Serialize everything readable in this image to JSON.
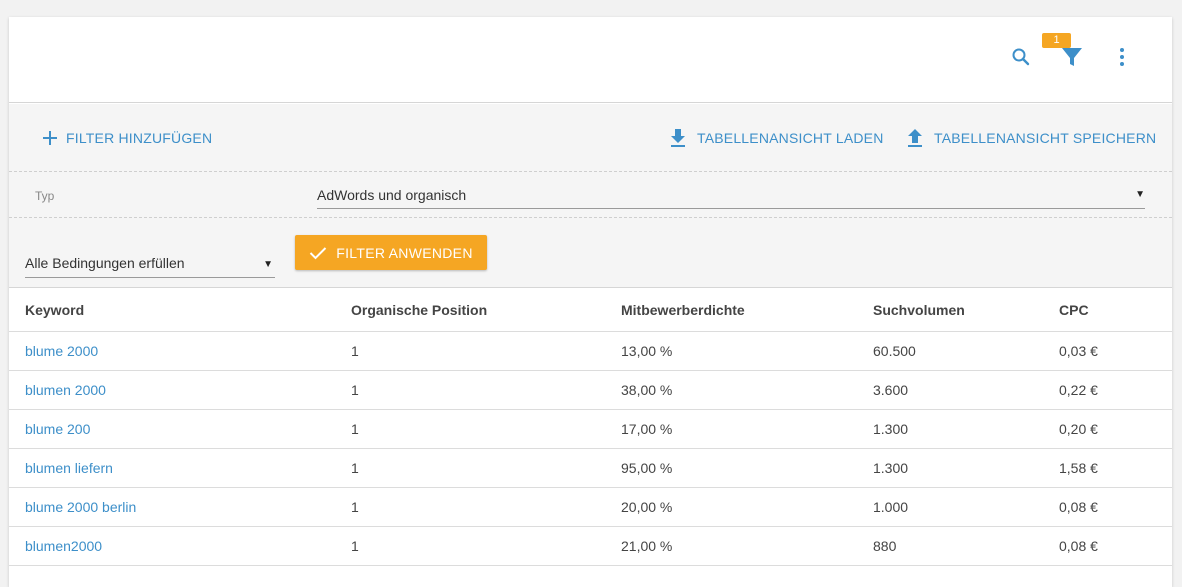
{
  "toolbar": {
    "filter_badge": "1",
    "icons": [
      "search-icon",
      "filter-icon",
      "more-vert-icon"
    ]
  },
  "actions": {
    "add_filter": "FILTER HINZUFÜGEN",
    "load_view": "TABELLENANSICHT LADEN",
    "save_view": "TABELLENANSICHT SPEICHERN"
  },
  "filter": {
    "type_label": "Typ",
    "type_value": "AdWords und organisch",
    "condition_value": "Alle Bedingungen erfüllen",
    "apply_label": "FILTER ANWENDEN"
  },
  "table": {
    "headers": [
      "Keyword",
      "Organische Position",
      "Mitbewerberdichte",
      "Suchvolumen",
      "CPC"
    ],
    "rows": [
      [
        "blume 2000",
        "1",
        "13,00 %",
        "60.500",
        "0,03 €"
      ],
      [
        "blumen 2000",
        "1",
        "38,00 %",
        "3.600",
        "0,22 €"
      ],
      [
        "blume 200",
        "1",
        "17,00 %",
        "1.300",
        "0,20 €"
      ],
      [
        "blumen liefern",
        "1",
        "95,00 %",
        "1.300",
        "1,58 €"
      ],
      [
        "blume 2000 berlin",
        "1",
        "20,00 %",
        "1.000",
        "0,08 €"
      ],
      [
        "blumen2000",
        "1",
        "21,00 %",
        "880",
        "0,08 €"
      ]
    ]
  },
  "colors": {
    "accent": "#3d8fc9",
    "button": "#f5a623",
    "panel_bg": "#f5f5f5"
  }
}
